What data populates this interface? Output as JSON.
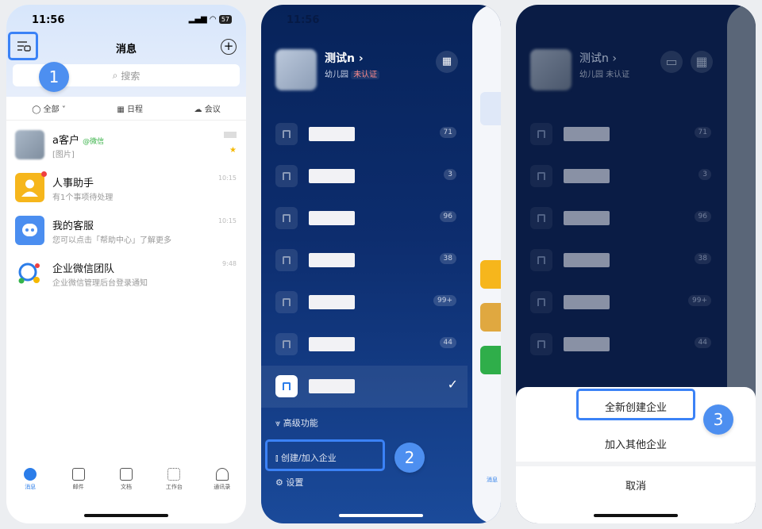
{
  "status_time": "11:56",
  "battery": "57",
  "panel1": {
    "title": "消息",
    "search_placeholder": "搜索",
    "filters": [
      "全部",
      "日程",
      "会议"
    ],
    "chats": [
      {
        "name": "a客户",
        "tag": "@微信",
        "preview": "[图片]",
        "time": ""
      },
      {
        "name": "人事助手",
        "tag": "",
        "preview": "有1个事项待处理",
        "time": "10:15"
      },
      {
        "name": "我的客服",
        "tag": "",
        "preview": "您可以点击「帮助中心」了解更多",
        "time": "10:15"
      },
      {
        "name": "企业微信团队",
        "tag": "",
        "preview": "企业微信管理后台登录通知",
        "time": "9:48"
      }
    ],
    "tabs": [
      "消息",
      "邮件",
      "文档",
      "工作台",
      "通讯录"
    ],
    "callout": "1"
  },
  "panel2": {
    "user_name": "测试n",
    "org": "幼儿园",
    "badge": "未认证",
    "counts": [
      "71",
      "3",
      "96",
      "38",
      "99+",
      "44"
    ],
    "advanced": "高级功能",
    "create_join": "创建/加入企业",
    "settings": "设置",
    "peek_tab": "消息",
    "callout": "2"
  },
  "panel3": {
    "create_new": "全新创建企业",
    "join_other": "加入其他企业",
    "cancel": "取消",
    "callout": "3"
  },
  "colors": {
    "accent": "#3b82f6",
    "callout": "#4d8ff0",
    "drawer": "#0d2d6e"
  }
}
